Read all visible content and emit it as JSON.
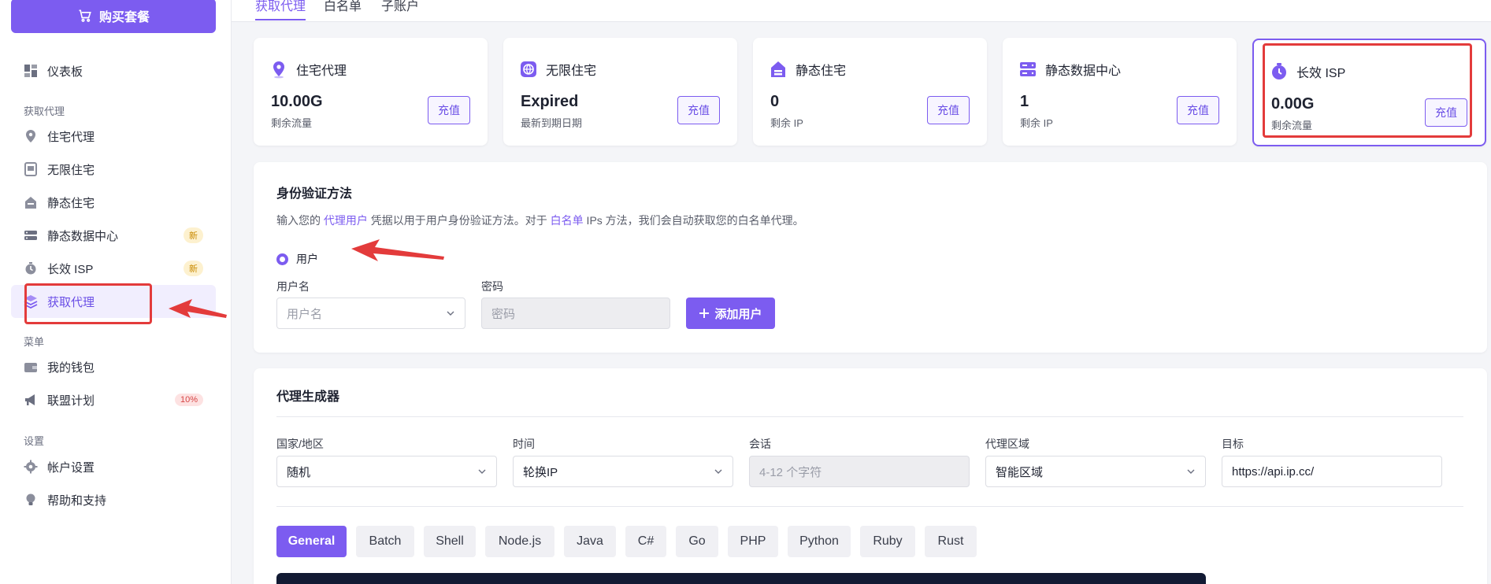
{
  "sidebar": {
    "buy_label": "购买套餐",
    "dashboard": "仪表板",
    "section_proxy": "获取代理",
    "items": [
      {
        "label": "住宅代理"
      },
      {
        "label": "无限住宅"
      },
      {
        "label": "静态住宅"
      },
      {
        "label": "静态数据中心",
        "badge": "新"
      },
      {
        "label": "长效 ISP",
        "badge": "新"
      },
      {
        "label": "获取代理"
      }
    ],
    "section_menu": "菜单",
    "wallet": "我的钱包",
    "affiliate": "联盟计划",
    "affiliate_badge": "10%",
    "section_settings": "设置",
    "account_settings": "帐户设置",
    "help": "帮助和支持"
  },
  "tabs": [
    "获取代理",
    "白名单",
    "子账户"
  ],
  "cards": [
    {
      "title": "住宅代理",
      "value": "10.00G",
      "sub": "剩余流量",
      "button": "充值",
      "icon": "location-pin-icon"
    },
    {
      "title": "无限住宅",
      "value": "Expired",
      "sub": "最新到期日期",
      "button": "充值",
      "icon": "globe-icon"
    },
    {
      "title": "静态住宅",
      "value": "0",
      "sub": "剩余 IP",
      "button": "充值",
      "icon": "house-icon"
    },
    {
      "title": "静态数据中心",
      "value": "1",
      "sub": "剩余 IP",
      "button": "充值",
      "icon": "server-icon"
    },
    {
      "title": "长效 ISP",
      "value": "0.00G",
      "sub": "剩余流量",
      "button": "充值",
      "icon": "stopwatch-icon"
    }
  ],
  "auth": {
    "title": "身份验证方法",
    "desc_1": "输入您的 ",
    "desc_link1": "代理用户",
    "desc_2": " 凭据以用于用户身份验证方法。对于 ",
    "desc_link2": "白名单",
    "desc_3": " IPs 方法，我们会自动获取您的白名单代理。",
    "radio_label": "用户",
    "username_label": "用户名",
    "username_placeholder": "用户名",
    "password_label": "密码",
    "password_placeholder": "密码",
    "add_user": "添加用户"
  },
  "generator": {
    "title": "代理生成器",
    "country_label": "国家/地区",
    "country_value": "随机",
    "time_label": "时间",
    "time_value": "轮换IP",
    "session_label": "会话",
    "session_placeholder": "4-12 个字符",
    "zone_label": "代理区域",
    "zone_value": "智能区域",
    "target_label": "目标",
    "target_value": "https://api.ip.cc/",
    "languages": [
      "General",
      "Batch",
      "Shell",
      "Node.js",
      "Java",
      "C#",
      "Go",
      "PHP",
      "Python",
      "Ruby",
      "Rust"
    ]
  },
  "colors": {
    "accent": "#7c5cf0",
    "annotation": "#e33b3b"
  }
}
